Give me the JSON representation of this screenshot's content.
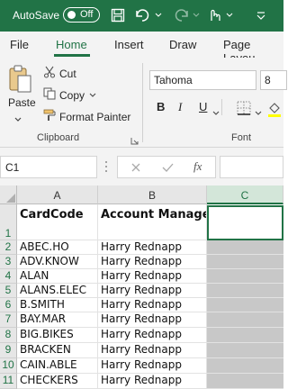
{
  "titlebar": {
    "autosave_label": "AutoSave",
    "toggle_label": "Off"
  },
  "tabs": [
    {
      "label": "File"
    },
    {
      "label": "Home"
    },
    {
      "label": "Insert"
    },
    {
      "label": "Draw"
    },
    {
      "label": "Page Layou"
    }
  ],
  "ribbon": {
    "paste_label": "Paste",
    "cut_label": "Cut",
    "copy_label": "Copy",
    "format_painter_label": "Format Painter",
    "clipboard_group_label": "Clipboard",
    "font_group_label": "Font",
    "font_name": "Tahoma",
    "font_size": "8",
    "bold": "B",
    "italic": "I",
    "underline": "U"
  },
  "formula_bar": {
    "name_box": "C1",
    "fx": "fx"
  },
  "grid": {
    "columns": [
      "A",
      "B",
      "C"
    ],
    "rows": [
      {
        "num": "1",
        "a": "CardCode",
        "b": "Account Manager"
      },
      {
        "num": "2",
        "a": "ABEC.HO",
        "b": "Harry Rednapp"
      },
      {
        "num": "3",
        "a": "ADV.KNOW",
        "b": "Harry Rednapp"
      },
      {
        "num": "4",
        "a": "ALAN",
        "b": "Harry Rednapp"
      },
      {
        "num": "5",
        "a": "ALANS.ELEC",
        "b": "Harry Rednapp"
      },
      {
        "num": "6",
        "a": "B.SMITH",
        "b": "Harry Rednapp"
      },
      {
        "num": "7",
        "a": "BAY.MAR",
        "b": "Harry Rednapp"
      },
      {
        "num": "8",
        "a": "BIG.BIKES",
        "b": "Harry Rednapp"
      },
      {
        "num": "9",
        "a": "BRACKEN",
        "b": "Harry Rednapp"
      },
      {
        "num": "10",
        "a": "CAIN.ABLE",
        "b": "Harry Rednapp"
      },
      {
        "num": "11",
        "a": "CHECKERS",
        "b": "Harry Rednapp"
      }
    ]
  },
  "colors": {
    "accent": "#217346",
    "ribbon_bg": "#f3f3f3"
  }
}
